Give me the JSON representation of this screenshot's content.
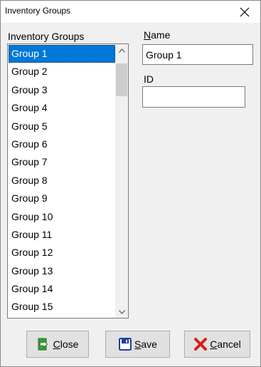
{
  "window": {
    "title": "Inventory Groups"
  },
  "labels": {
    "groups": "Inventory Groups",
    "name_first": "N",
    "name_rest": "ame",
    "id": "ID"
  },
  "list": {
    "items": [
      "Group 1",
      "Group 2",
      "Group 3",
      "Group 4",
      "Group 5",
      "Group 6",
      "Group 7",
      "Group 8",
      "Group 9",
      "Group 10",
      "Group 11",
      "Group 12",
      "Group 13",
      "Group 14",
      "Group 15"
    ],
    "selected_index": 0
  },
  "fields": {
    "name_value": "Group 1",
    "id_value": ""
  },
  "buttons": {
    "close_first": "C",
    "close_rest": "lose",
    "save_first": "S",
    "save_rest": "ave",
    "cancel_first": "C",
    "cancel_rest": "ancel"
  },
  "icons": {
    "close": "door-exit-icon",
    "save": "floppy-disk-icon",
    "cancel": "red-x-icon",
    "scroll_up": "chevron-up-icon",
    "scroll_down": "chevron-down-icon",
    "title_close": "close-icon"
  },
  "colors": {
    "selection": "#0078d7",
    "close_icon_green": "#3a9a3a",
    "save_icon_blue": "#1e3fa0",
    "cancel_icon_red": "#d81e1e"
  }
}
